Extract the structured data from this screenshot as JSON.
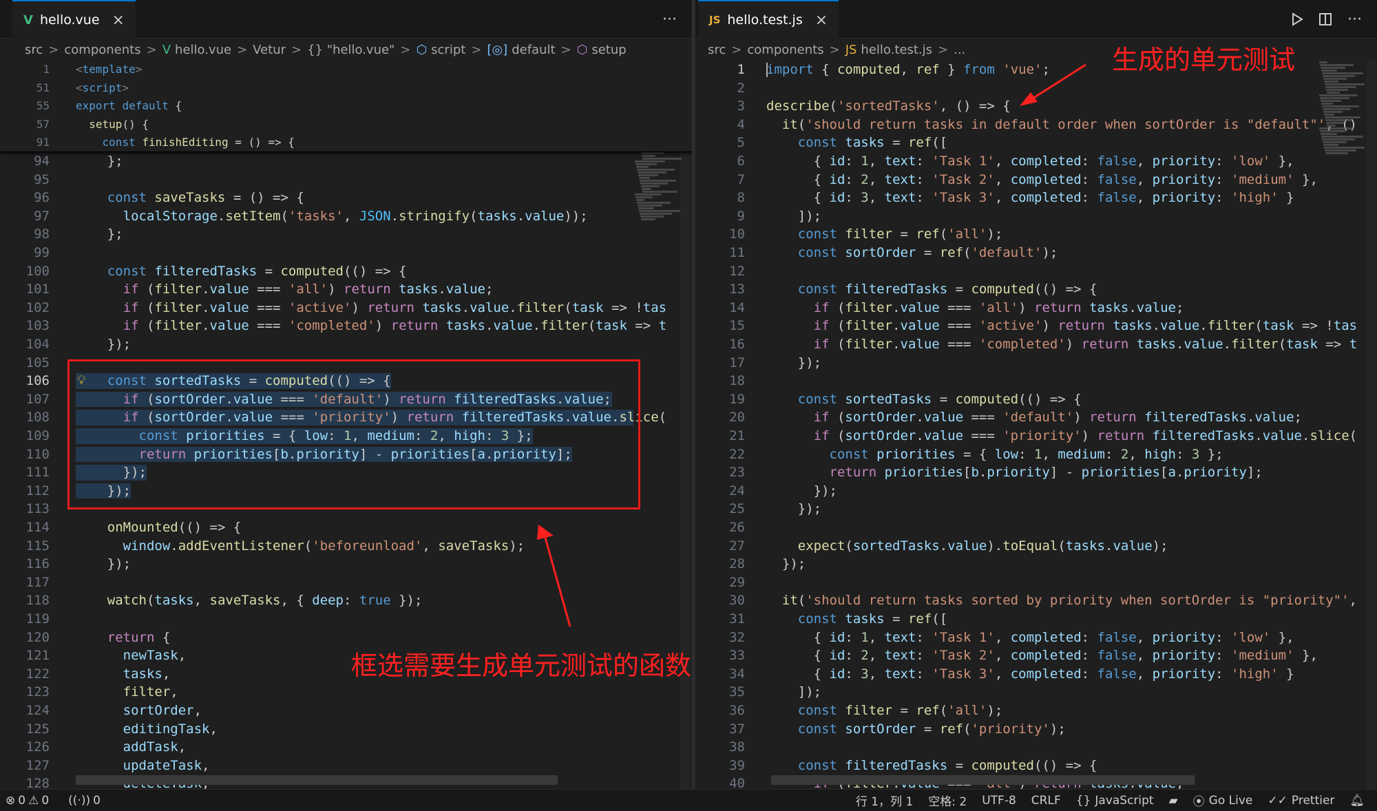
{
  "left": {
    "tab": {
      "icon": "V",
      "label": "hello.vue",
      "close": "×"
    },
    "more": "···",
    "breadcrumb": [
      "src",
      "components",
      "hello.vue",
      "Vetur",
      "{} \"hello.vue\"",
      "script",
      "default",
      "setup"
    ],
    "sticky": [
      {
        "n": "1",
        "t": "<template>"
      },
      {
        "n": "51",
        "t": "<script>"
      },
      {
        "n": "55",
        "t": "export default {"
      },
      {
        "n": "57",
        "t": "  setup() {"
      },
      {
        "n": "91",
        "t": "    const finishEditing = () => {"
      }
    ],
    "lines": [
      {
        "n": "94",
        "t": "    };"
      },
      {
        "n": "95",
        "t": ""
      },
      {
        "n": "96",
        "t": "    const saveTasks = () => {"
      },
      {
        "n": "97",
        "t": "      localStorage.setItem('tasks', JSON.stringify(tasks.value));"
      },
      {
        "n": "98",
        "t": "    };"
      },
      {
        "n": "99",
        "t": ""
      },
      {
        "n": "100",
        "t": "    const filteredTasks = computed(() => {"
      },
      {
        "n": "101",
        "t": "      if (filter.value === 'all') return tasks.value;"
      },
      {
        "n": "102",
        "t": "      if (filter.value === 'active') return tasks.value.filter(task => !tas"
      },
      {
        "n": "103",
        "t": "      if (filter.value === 'completed') return tasks.value.filter(task => t"
      },
      {
        "n": "104",
        "t": "    });"
      },
      {
        "n": "105",
        "t": ""
      },
      {
        "n": "106",
        "t": "    const sortedTasks = computed(() => {"
      },
      {
        "n": "107",
        "t": "      if (sortOrder.value === 'default') return filteredTasks.value;"
      },
      {
        "n": "108",
        "t": "      if (sortOrder.value === 'priority') return filteredTasks.value.slice("
      },
      {
        "n": "109",
        "t": "        const priorities = { low: 1, medium: 2, high: 3 };"
      },
      {
        "n": "110",
        "t": "        return priorities[b.priority] - priorities[a.priority];"
      },
      {
        "n": "111",
        "t": "      });"
      },
      {
        "n": "112",
        "t": "    });"
      },
      {
        "n": "113",
        "t": ""
      },
      {
        "n": "114",
        "t": "    onMounted(() => {"
      },
      {
        "n": "115",
        "t": "      window.addEventListener('beforeunload', saveTasks);"
      },
      {
        "n": "116",
        "t": "    });"
      },
      {
        "n": "117",
        "t": ""
      },
      {
        "n": "118",
        "t": "    watch(tasks, saveTasks, { deep: true });"
      },
      {
        "n": "119",
        "t": ""
      },
      {
        "n": "120",
        "t": "    return {"
      },
      {
        "n": "121",
        "t": "      newTask,"
      },
      {
        "n": "122",
        "t": "      tasks,"
      },
      {
        "n": "123",
        "t": "      filter,"
      },
      {
        "n": "124",
        "t": "      sortOrder,"
      },
      {
        "n": "125",
        "t": "      editingTask,"
      },
      {
        "n": "126",
        "t": "      addTask,"
      },
      {
        "n": "127",
        "t": "      updateTask,"
      },
      {
        "n": "128",
        "t": "      deleteTask,"
      }
    ],
    "annotation": "框选需要生成单元测试的函数"
  },
  "right": {
    "tab": {
      "icon": "JS",
      "label": "hello.test.js",
      "close": "×"
    },
    "breadcrumb": [
      "src",
      "components",
      "hello.test.js",
      "..."
    ],
    "lines": [
      {
        "n": "1",
        "t": "import { computed, ref } from 'vue';"
      },
      {
        "n": "2",
        "t": ""
      },
      {
        "n": "3",
        "t": "describe('sortedTasks', () => {"
      },
      {
        "n": "4",
        "t": "  it('should return tasks in default order when sortOrder is \"default\"', ()"
      },
      {
        "n": "5",
        "t": "    const tasks = ref(["
      },
      {
        "n": "6",
        "t": "      { id: 1, text: 'Task 1', completed: false, priority: 'low' },"
      },
      {
        "n": "7",
        "t": "      { id: 2, text: 'Task 2', completed: false, priority: 'medium' },"
      },
      {
        "n": "8",
        "t": "      { id: 3, text: 'Task 3', completed: false, priority: 'high' }"
      },
      {
        "n": "9",
        "t": "    ]);"
      },
      {
        "n": "10",
        "t": "    const filter = ref('all');"
      },
      {
        "n": "11",
        "t": "    const sortOrder = ref('default');"
      },
      {
        "n": "12",
        "t": ""
      },
      {
        "n": "13",
        "t": "    const filteredTasks = computed(() => {"
      },
      {
        "n": "14",
        "t": "      if (filter.value === 'all') return tasks.value;"
      },
      {
        "n": "15",
        "t": "      if (filter.value === 'active') return tasks.value.filter(task => !tas"
      },
      {
        "n": "16",
        "t": "      if (filter.value === 'completed') return tasks.value.filter(task => t"
      },
      {
        "n": "17",
        "t": "    });"
      },
      {
        "n": "18",
        "t": ""
      },
      {
        "n": "19",
        "t": "    const sortedTasks = computed(() => {"
      },
      {
        "n": "20",
        "t": "      if (sortOrder.value === 'default') return filteredTasks.value;"
      },
      {
        "n": "21",
        "t": "      if (sortOrder.value === 'priority') return filteredTasks.value.slice("
      },
      {
        "n": "22",
        "t": "        const priorities = { low: 1, medium: 2, high: 3 };"
      },
      {
        "n": "23",
        "t": "        return priorities[b.priority] - priorities[a.priority];"
      },
      {
        "n": "24",
        "t": "      });"
      },
      {
        "n": "25",
        "t": "    });"
      },
      {
        "n": "26",
        "t": ""
      },
      {
        "n": "27",
        "t": "    expect(sortedTasks.value).toEqual(tasks.value);"
      },
      {
        "n": "28",
        "t": "  });"
      },
      {
        "n": "29",
        "t": ""
      },
      {
        "n": "30",
        "t": "  it('should return tasks sorted by priority when sortOrder is \"priority\"',"
      },
      {
        "n": "31",
        "t": "    const tasks = ref(["
      },
      {
        "n": "32",
        "t": "      { id: 1, text: 'Task 1', completed: false, priority: 'low' },"
      },
      {
        "n": "33",
        "t": "      { id: 2, text: 'Task 2', completed: false, priority: 'medium' },"
      },
      {
        "n": "34",
        "t": "      { id: 3, text: 'Task 3', completed: false, priority: 'high' }"
      },
      {
        "n": "35",
        "t": "    ]);"
      },
      {
        "n": "36",
        "t": "    const filter = ref('all');"
      },
      {
        "n": "37",
        "t": "    const sortOrder = ref('priority');"
      },
      {
        "n": "38",
        "t": ""
      },
      {
        "n": "39",
        "t": "    const filteredTasks = computed(() => {"
      },
      {
        "n": "40",
        "t": "      if (filter.value === 'all') return tasks.value;"
      }
    ],
    "annotation": "生成的单元测试"
  },
  "status": {
    "errors": "0",
    "warnings": "0",
    "ports": "0",
    "position": "行 1，列 1",
    "spaces": "空格: 2",
    "encoding": "UTF-8",
    "eol": "CRLF",
    "language": "JavaScript",
    "golive": "Go Live",
    "prettier": "Prettier"
  },
  "colors": {
    "accent": "#0078d4",
    "annotation": "#ff2020",
    "vue": "#41b883",
    "js": "#e8b03a"
  }
}
